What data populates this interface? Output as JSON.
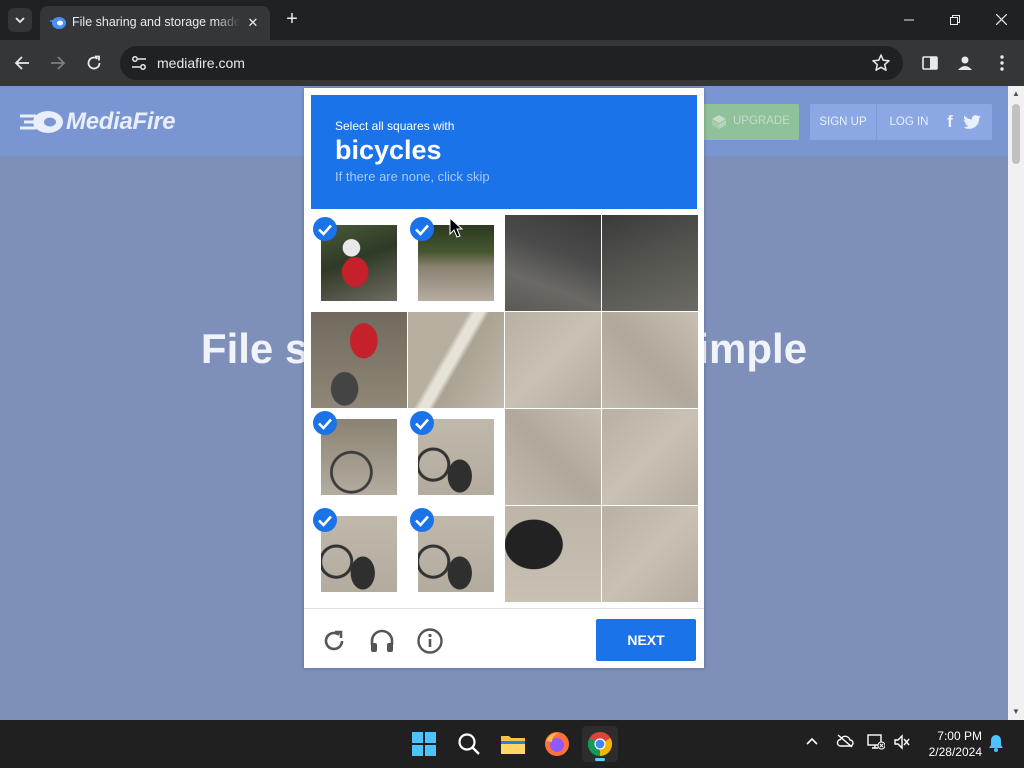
{
  "browser": {
    "tab_title": "File sharing and storage made simple",
    "url": "mediafire.com"
  },
  "site": {
    "logo_text": "MediaFire",
    "upgrade_label": "UPGRADE",
    "signup_label": "SIGN UP",
    "login_label": "LOG IN",
    "hero_left": "File storag",
    "hero_right": "de simple"
  },
  "captcha": {
    "prompt_pre": "Select all squares with",
    "target": "bicycles",
    "prompt_sub": "If there are none, click skip",
    "next_label": "NEXT",
    "tiles": [
      {
        "selected": true
      },
      {
        "selected": true
      },
      {
        "selected": false
      },
      {
        "selected": false
      },
      {
        "selected": false
      },
      {
        "selected": false
      },
      {
        "selected": false
      },
      {
        "selected": false
      },
      {
        "selected": true
      },
      {
        "selected": true
      },
      {
        "selected": false
      },
      {
        "selected": false
      },
      {
        "selected": true
      },
      {
        "selected": true
      },
      {
        "selected": false
      },
      {
        "selected": false
      }
    ],
    "accent": "#1a73e8"
  },
  "taskbar": {
    "time": "7:00 PM",
    "date": "2/28/2024",
    "accent": "#60cdff"
  }
}
